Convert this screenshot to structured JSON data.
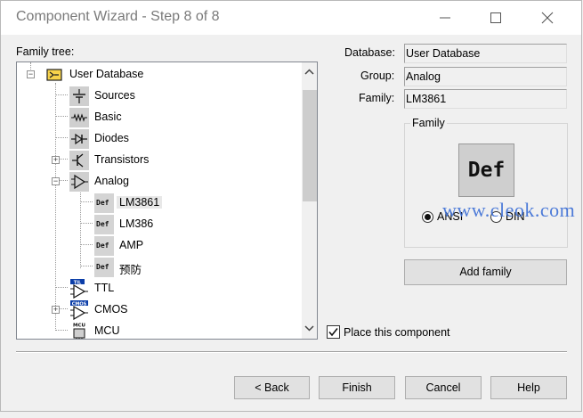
{
  "window": {
    "title": "Component Wizard - Step 8 of 8"
  },
  "tree": {
    "label": "Family tree:",
    "items": [
      {
        "label": "User Database",
        "icon": "database-icon",
        "level": 0,
        "expander": "−"
      },
      {
        "label": "Sources",
        "icon": "sources-icon",
        "level": 1
      },
      {
        "label": "Basic",
        "icon": "basic-icon",
        "level": 1
      },
      {
        "label": "Diodes",
        "icon": "diode-icon",
        "level": 1
      },
      {
        "label": "Transistors",
        "icon": "transistor-icon",
        "level": 1,
        "expander": "+"
      },
      {
        "label": "Analog",
        "icon": "opamp-icon",
        "level": 1,
        "expander": "−"
      },
      {
        "label": "LM3861",
        "icon": "def-icon",
        "level": 2,
        "selected": true
      },
      {
        "label": "LM386",
        "icon": "def-icon",
        "level": 2
      },
      {
        "label": "AMP",
        "icon": "def-icon",
        "level": 2
      },
      {
        "label": "预防",
        "icon": "def-icon",
        "level": 2
      },
      {
        "label": "TTL",
        "icon": "ttl-icon",
        "level": 1
      },
      {
        "label": "CMOS",
        "icon": "cmos-icon",
        "level": 1,
        "expander": "+"
      },
      {
        "label": "MCU",
        "icon": "mcu-icon",
        "level": 1
      }
    ],
    "def_icon_text": "Def",
    "icon_tags": {
      "ttl": "TIL",
      "cmos": "CMOS",
      "mcu": "MCU"
    }
  },
  "details": {
    "database_label": "Database:",
    "database_value": "User Database",
    "group_label": "Group:",
    "group_value": "Analog",
    "family_label": "Family:",
    "family_value": "LM3861"
  },
  "family_box": {
    "title": "Family",
    "preview_text": "Def",
    "ansi_label": "ANSI",
    "din_label": "DIN",
    "selected": "ANSI"
  },
  "buttons": {
    "add_family": "Add family",
    "back": "< Back",
    "finish": "Finish",
    "cancel": "Cancel",
    "help": "Help"
  },
  "place_component": {
    "label": "Place this component",
    "checked": true
  },
  "watermark": "www.cleok.com",
  "colors": {
    "watermark": "#3c6fd6",
    "icon_bg": "#cfcfcf",
    "accent_blue": "#0a3da8"
  }
}
